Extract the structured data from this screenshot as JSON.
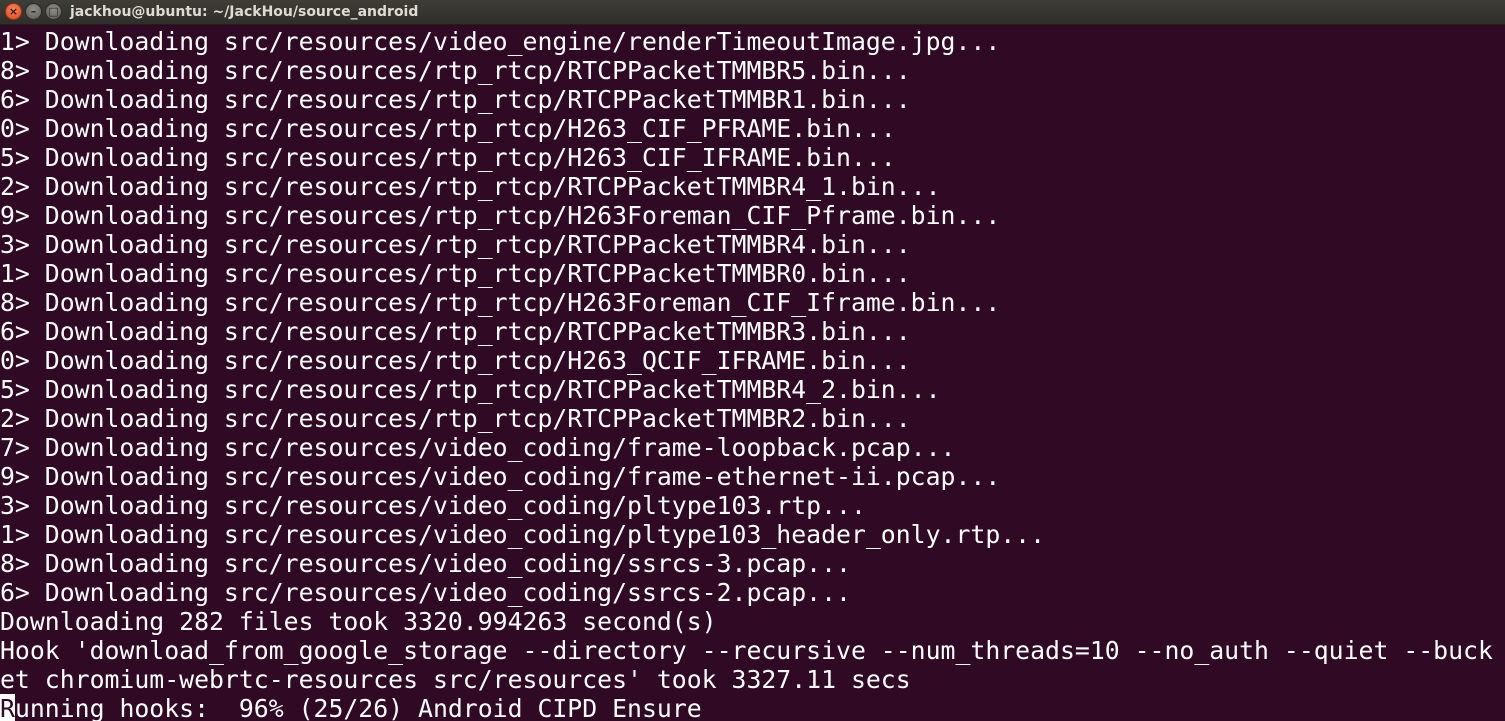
{
  "window": {
    "title": "jackhou@ubuntu: ~/JackHou/source_android",
    "controls": {
      "close": "×",
      "minimize": "–",
      "maximize": "□"
    }
  },
  "terminal": {
    "lines": [
      "1> Downloading src/resources/video_engine/renderTimeoutImage.jpg...",
      "8> Downloading src/resources/rtp_rtcp/RTCPPacketTMMBR5.bin...",
      "6> Downloading src/resources/rtp_rtcp/RTCPPacketTMMBR1.bin...",
      "0> Downloading src/resources/rtp_rtcp/H263_CIF_PFRAME.bin...",
      "5> Downloading src/resources/rtp_rtcp/H263_CIF_IFRAME.bin...",
      "2> Downloading src/resources/rtp_rtcp/RTCPPacketTMMBR4_1.bin...",
      "9> Downloading src/resources/rtp_rtcp/H263Foreman_CIF_Pframe.bin...",
      "3> Downloading src/resources/rtp_rtcp/RTCPPacketTMMBR4.bin...",
      "1> Downloading src/resources/rtp_rtcp/RTCPPacketTMMBR0.bin...",
      "8> Downloading src/resources/rtp_rtcp/H263Foreman_CIF_Iframe.bin...",
      "6> Downloading src/resources/rtp_rtcp/RTCPPacketTMMBR3.bin...",
      "0> Downloading src/resources/rtp_rtcp/H263_QCIF_IFRAME.bin...",
      "5> Downloading src/resources/rtp_rtcp/RTCPPacketTMMBR4_2.bin...",
      "2> Downloading src/resources/rtp_rtcp/RTCPPacketTMMBR2.bin...",
      "7> Downloading src/resources/video_coding/frame-loopback.pcap...",
      "9> Downloading src/resources/video_coding/frame-ethernet-ii.pcap...",
      "3> Downloading src/resources/video_coding/pltype103.rtp...",
      "1> Downloading src/resources/video_coding/pltype103_header_only.rtp...",
      "8> Downloading src/resources/video_coding/ssrcs-3.pcap...",
      "6> Downloading src/resources/video_coding/ssrcs-2.pcap...",
      "Downloading 282 files took 3320.994263 second(s)",
      "Hook 'download_from_google_storage --directory --recursive --num_threads=10 --no_auth --quiet --buck",
      "et chromium-webrtc-resources src/resources' took 3327.11 secs"
    ],
    "last_line": {
      "cursor_char": "R",
      "text": "unning hooks:  96% (25/26) Android CIPD Ensure"
    }
  }
}
